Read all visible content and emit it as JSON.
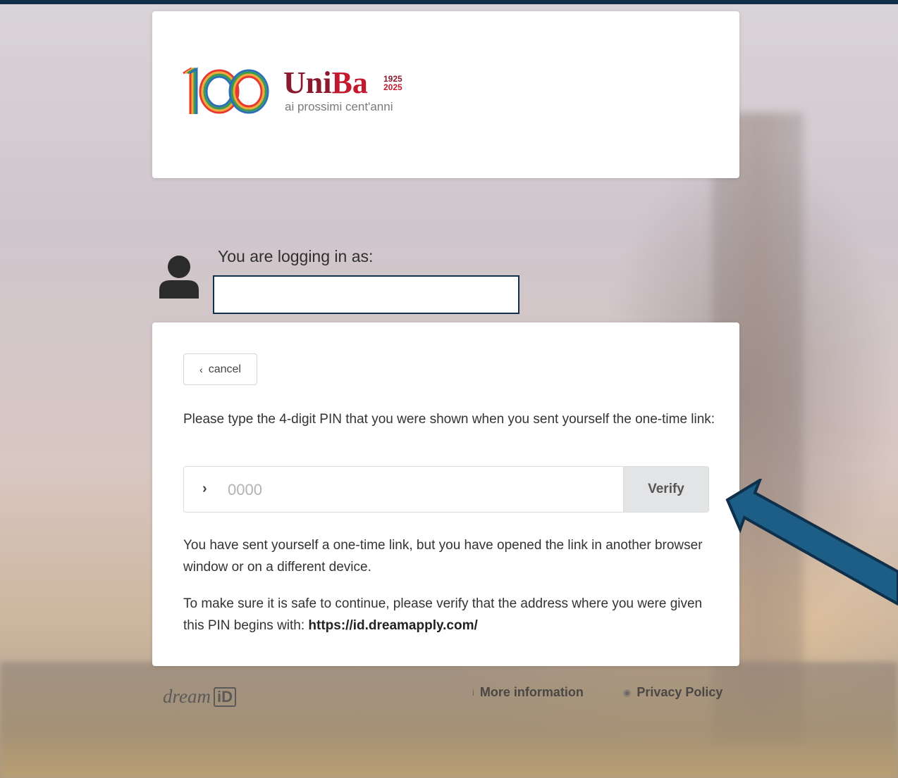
{
  "colors": {
    "top_bar": "#0f2f4a",
    "card_bg": "#ffffff",
    "uniba_dark": "#8b1a2e",
    "uniba_red": "#c2192f",
    "verify_bg": "#e3e4e6",
    "arrow": "#1d5e86",
    "arrow_outline": "#0f2f4a"
  },
  "logo": {
    "mark": "100",
    "name_part1": "Uni",
    "name_part2": "Ba",
    "year_start": "1925",
    "year_end": "2025",
    "tagline": "ai prossimi cent'anni"
  },
  "login": {
    "logging_in_as": "You are logging in as:",
    "user_icon": "person-icon",
    "email_value": ""
  },
  "pin_form": {
    "cancel_label": "cancel",
    "cancel_icon": "chevron-left-icon",
    "instruction": "Please type the 4-digit PIN that you were shown when you sent yourself the one-time link:",
    "input_icon": "chevron-right-icon",
    "input_placeholder": "0000",
    "input_value": "",
    "verify_label": "Verify",
    "info_text": "You have sent yourself a one-time link, but you have opened the link in another browser window or on a different device.",
    "safety_text": "To make sure it is safe to continue, please verify that the address where you were given this PIN begins with:",
    "safety_url": "https://id.dreamapply.com/"
  },
  "footer": {
    "brand_word": "dream",
    "brand_id": "iD",
    "more_info_label": "More information",
    "more_info_icon": "info-icon",
    "privacy_label": "Privacy Policy",
    "privacy_icon": "shield-icon"
  },
  "annotation": {
    "arrow_icon": "pointer-arrow"
  }
}
